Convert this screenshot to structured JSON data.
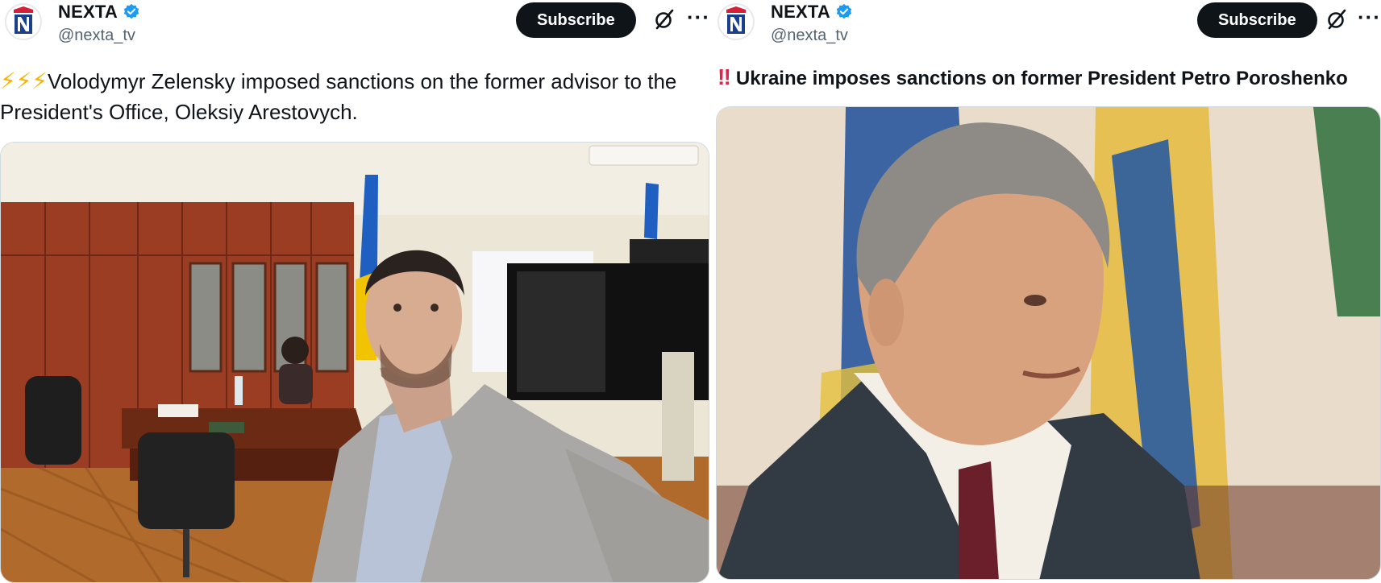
{
  "posts": [
    {
      "account": {
        "name": "NEXTA",
        "handle": "@nexta_tv"
      },
      "subscribe_label": "Subscribe",
      "more_label": "···",
      "prefix_icons": [
        "lightning-icon",
        "lightning-icon",
        "lightning-icon"
      ],
      "text": "Volodymyr Zelensky imposed sanctions on the former advisor to the President's Office, Oleksiy Arestovych.",
      "media": {
        "description_icon": "photo-office-selfie"
      }
    },
    {
      "account": {
        "name": "NEXTA",
        "handle": "@nexta_tv"
      },
      "subscribe_label": "Subscribe",
      "more_label": "···",
      "prefix_text": "‼",
      "text": "Ukraine imposes sanctions on former President Petro Poroshenko",
      "media": {
        "description_icon": "photo-portrait"
      }
    }
  ],
  "colors": {
    "verified": "#1d9bf0",
    "subscribe_bg": "#0f1419",
    "handle": "#536471",
    "bolt": "#f5b400",
    "bang": "#e0244a"
  }
}
